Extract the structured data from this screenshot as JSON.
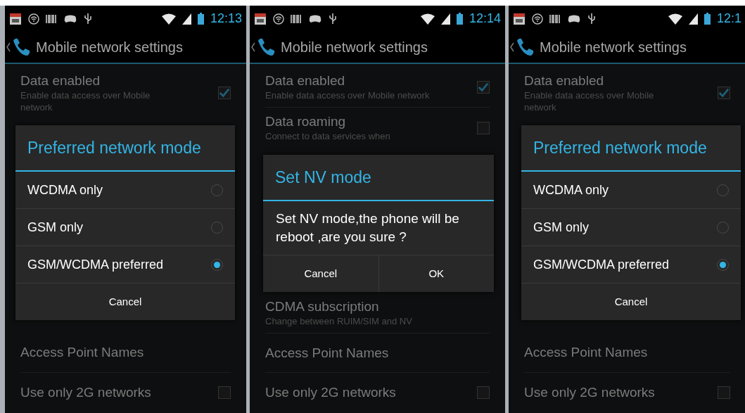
{
  "screens": [
    {
      "status_bar": {
        "time": "12:13"
      },
      "title": "Mobile network settings",
      "settings_above": [
        {
          "title": "Data enabled",
          "summary": "Enable data access over Mobile network",
          "kind": "checkbox",
          "checked": true
        }
      ],
      "settings_below": [
        {
          "title": "Access Point Names",
          "kind": "plain"
        },
        {
          "title": "Use only 2G networks",
          "kind": "checkbox",
          "checked": false
        }
      ],
      "dialog": {
        "kind": "choice",
        "title": "Preferred network mode",
        "options": [
          {
            "label": "WCDMA only",
            "selected": false
          },
          {
            "label": "GSM only",
            "selected": false
          },
          {
            "label": "GSM/WCDMA preferred",
            "selected": true
          }
        ],
        "buttons": [
          "Cancel"
        ]
      }
    },
    {
      "status_bar": {
        "time": "12:14"
      },
      "title": "Mobile network settings",
      "settings_above": [
        {
          "title": "Data enabled",
          "summary": "Enable data access over Mobile network",
          "kind": "checkbox",
          "checked": true
        },
        {
          "title": "Data roaming",
          "summary": "Connect to data services when",
          "kind": "checkbox",
          "checked": false
        }
      ],
      "settings_below": [
        {
          "title": "CDMA subscription",
          "summary": "Change between RUIM/SIM and NV",
          "kind": "plain"
        },
        {
          "title": "Access Point Names",
          "kind": "plain"
        },
        {
          "title": "Use only 2G networks",
          "kind": "checkbox",
          "checked": false
        }
      ],
      "dialog": {
        "kind": "confirm",
        "title": "Set NV mode",
        "message": "Set NV mode,the phone will be reboot ,are you sure ?",
        "buttons": [
          "Cancel",
          "OK"
        ]
      }
    },
    {
      "status_bar": {
        "time": "12:1"
      },
      "title": "Mobile network settings",
      "settings_above": [
        {
          "title": "Data enabled",
          "summary": "Enable data access over Mobile network",
          "kind": "checkbox",
          "checked": true
        }
      ],
      "settings_below": [
        {
          "title": "Access Point Names",
          "kind": "plain"
        },
        {
          "title": "Use only 2G networks",
          "kind": "checkbox",
          "checked": false
        }
      ],
      "dialog": {
        "kind": "choice",
        "title": "Preferred network mode",
        "options": [
          {
            "label": "WCDMA only",
            "selected": false
          },
          {
            "label": "GSM only",
            "selected": false
          },
          {
            "label": "GSM/WCDMA preferred",
            "selected": true
          }
        ],
        "buttons": [
          "Cancel"
        ]
      }
    }
  ]
}
